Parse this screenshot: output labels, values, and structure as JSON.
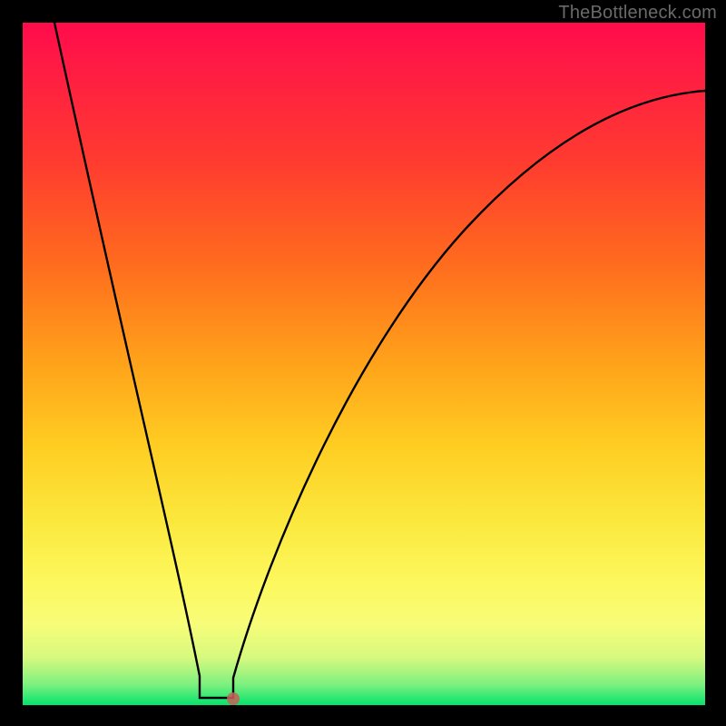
{
  "watermark": "TheBottleneck.com",
  "chart_data": {
    "type": "line",
    "title": "",
    "xlabel": "",
    "ylabel": "",
    "xlim": [
      0,
      100
    ],
    "ylim": [
      0,
      100
    ],
    "x": [
      5,
      10,
      15,
      20,
      25,
      26,
      28,
      30,
      31,
      35,
      45,
      55,
      65,
      75,
      85,
      95,
      100
    ],
    "values": [
      100,
      73,
      49,
      25,
      5,
      1,
      1,
      1,
      4,
      24,
      53,
      70,
      80,
      86,
      89,
      90,
      90
    ],
    "marker": {
      "x": 31,
      "y": 1
    },
    "gradient_meaning": "background runs from red (bad/bottleneck) at top to green (good) at bottom",
    "grid": false,
    "legend": false
  }
}
